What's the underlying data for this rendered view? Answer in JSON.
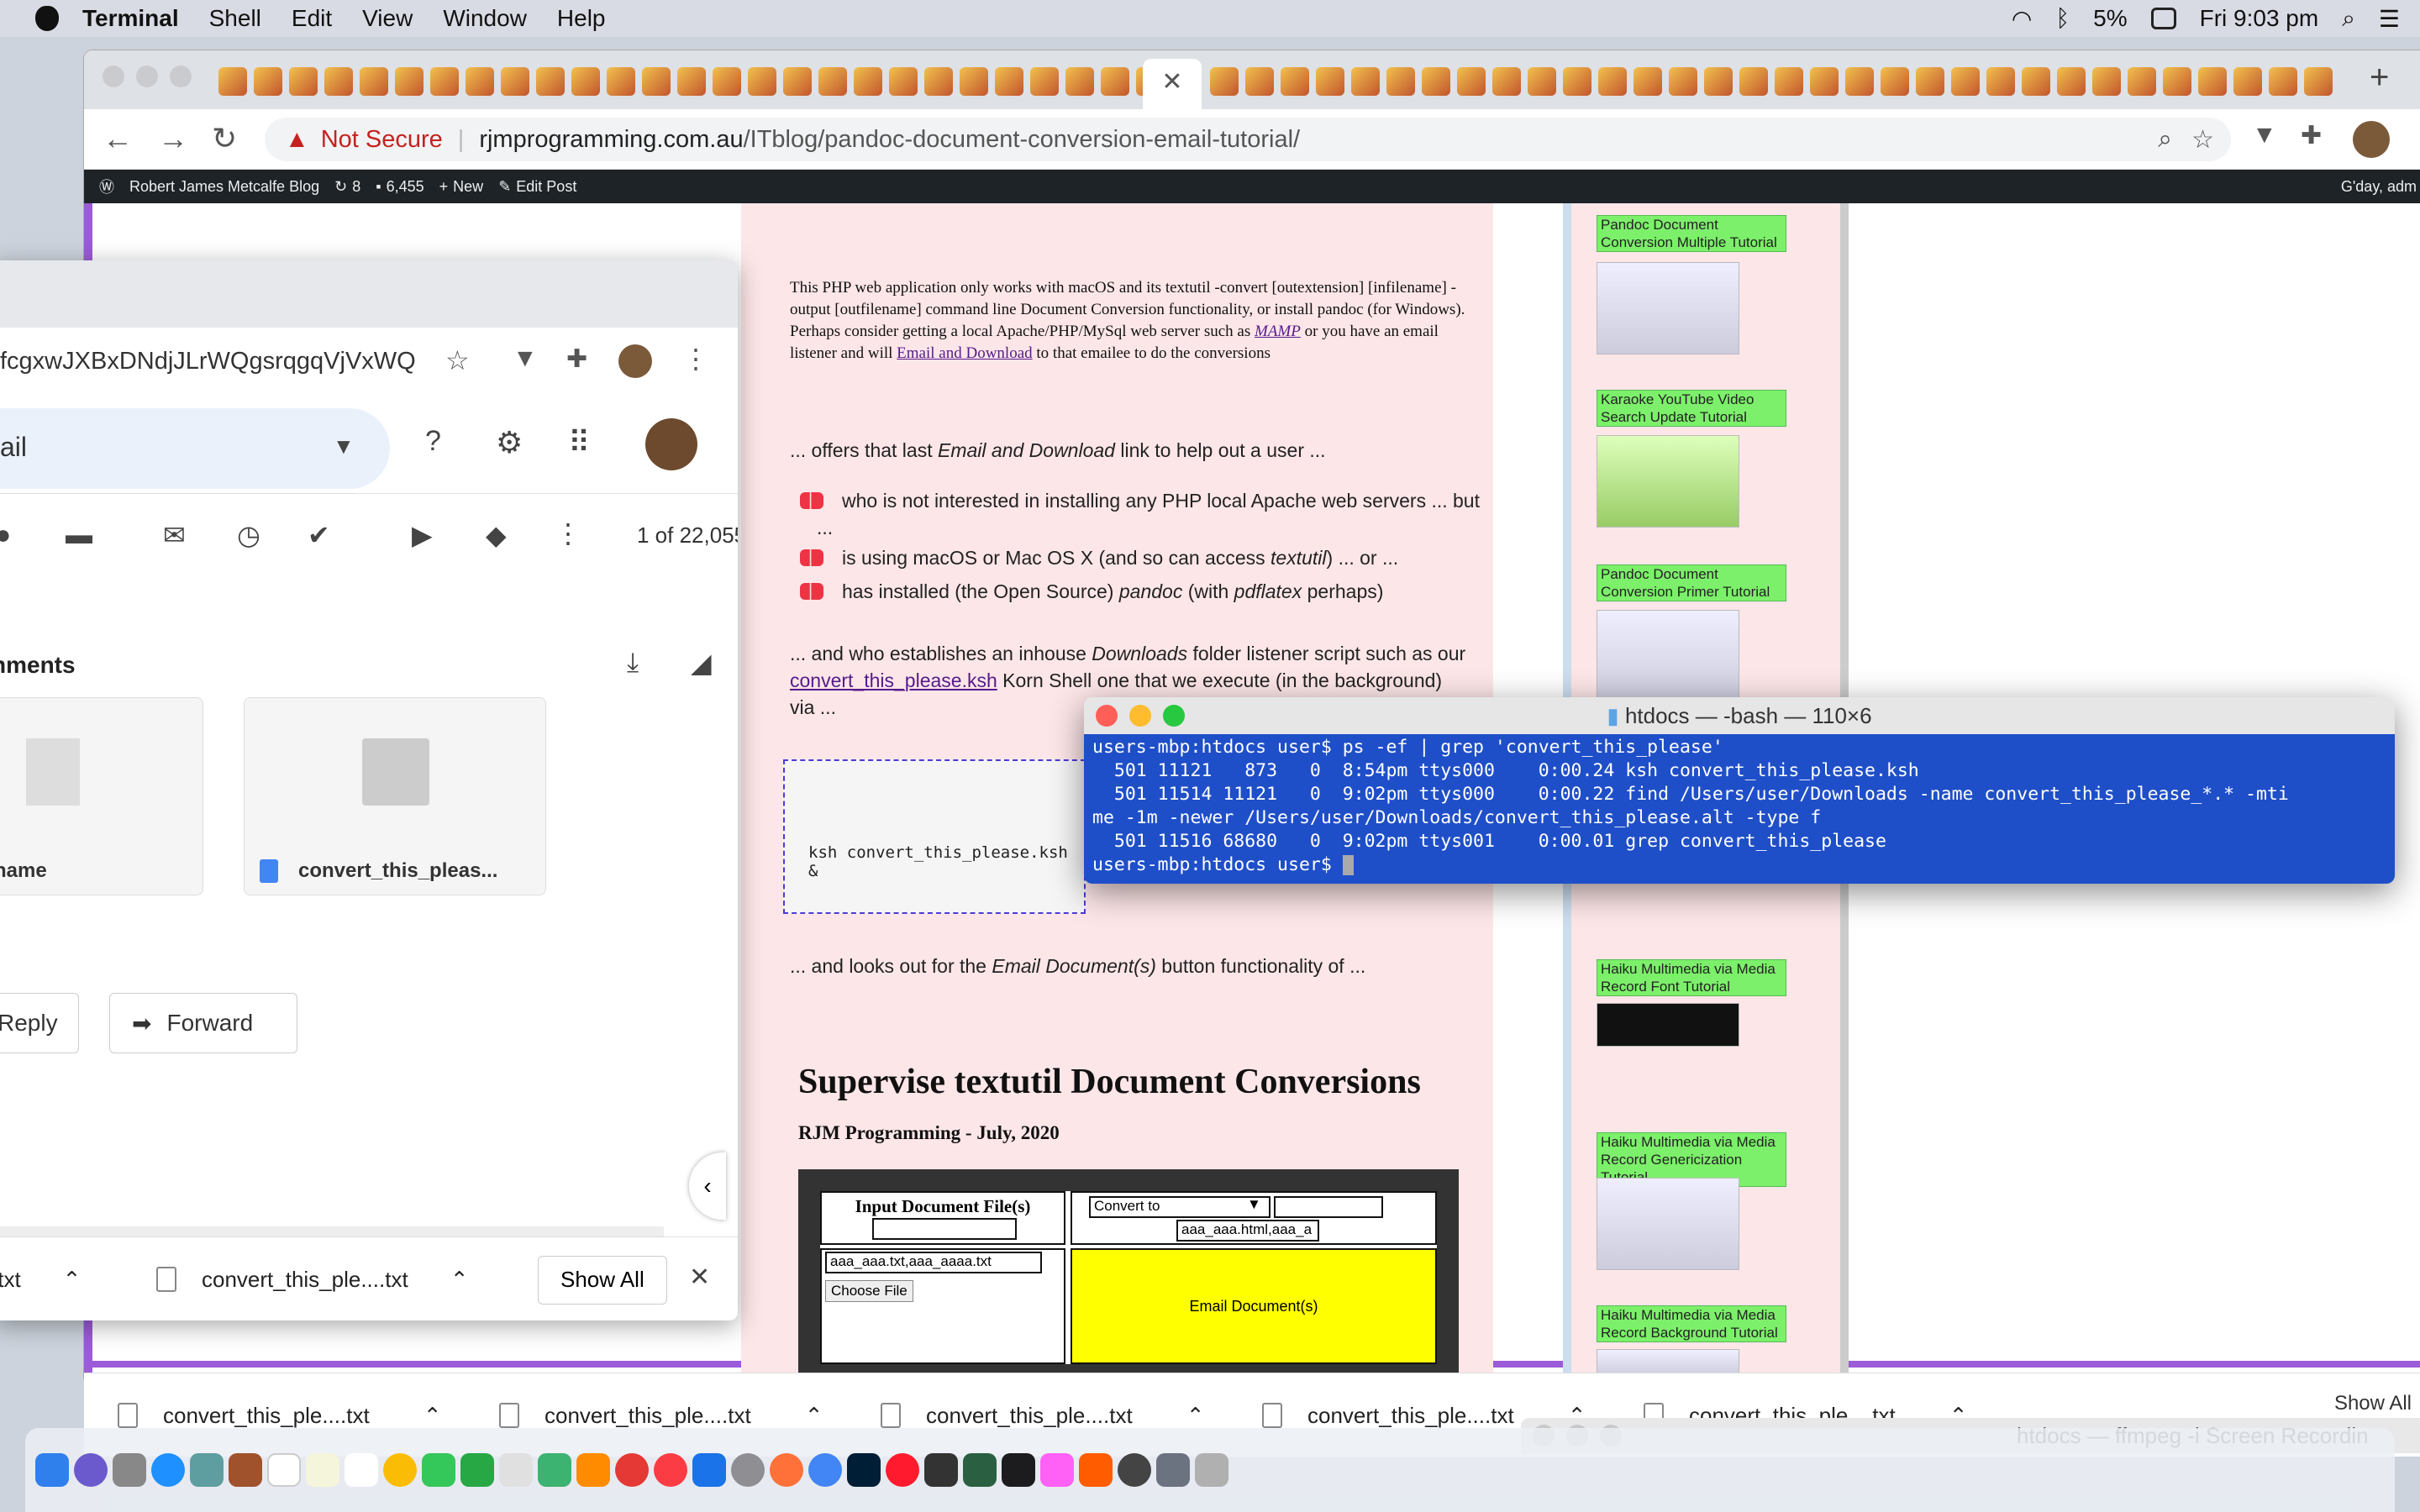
{
  "menubar": {
    "app": "Terminal",
    "items": [
      "Shell",
      "Edit",
      "View",
      "Window",
      "Help"
    ],
    "battery": "5%",
    "clock": "Fri 9:03 pm"
  },
  "browser": {
    "not_secure": "Not Secure",
    "url_host": "rjmprogramming.com.au",
    "url_path": "/ITblog/pandoc-document-conversion-email-tutorial/"
  },
  "wpbar": {
    "site": "Robert James Metcalfe Blog",
    "updates": "8",
    "comments": "6,455",
    "new": "New",
    "edit": "Edit Post",
    "greeting": "G'day, adm"
  },
  "article": {
    "banner_a": "This PHP web application only works with macOS and its textutil -convert [outextension] [infilename] -output [outfilename] command line Document Conversion functionality, or install pandoc (for Windows). Perhaps consider getting a local Apache/PHP/MySql web server such as ",
    "banner_link1": "MAMP",
    "banner_b": " or you have an email listener and will ",
    "banner_link2": "Email and Download",
    "banner_c": " to that emailee to do the conversions",
    "p1a": "... offers that last ",
    "p1i": "Email and Download",
    "p1b": " link to help out a user ...",
    "b1": "who is not interested in installing any PHP local Apache web servers ... but ...",
    "b2a": "is using macOS or Mac OS X (and so can access ",
    "b2i": "textutil",
    "b2b": ") ... or ...",
    "b3a": "has installed (the Open Source) ",
    "b3i1": "pandoc",
    "b3b": " (with ",
    "b3i2": "pdflatex",
    "b3c": " perhaps)",
    "p2a": "... and who establishes an inhouse ",
    "p2i": "Downloads",
    "p2b": " folder listener script such as our",
    "p2link": "convert_this_please.ksh",
    "p2c": " Korn Shell one that we execute (in the background)",
    "p2d": "via ...",
    "code": "ksh convert_this_please.ksh &",
    "p3a": "... and looks out for the ",
    "p3i": "Email Document(s)",
    "p3b": " button functionality of ...",
    "heading": "Supervise textutil Document Conversions",
    "byline": "RJM Programming - July, 2020",
    "form": {
      "input_label": "Input Document File(s)",
      "convert_to": "Convert to",
      "output_value": "aaa_aaa.html,aaa_a",
      "input_value": "aaa_aaa.txt,aaa_aaaa.txt",
      "choose_file": "Choose File",
      "email_btn": "Email Document(s)"
    }
  },
  "sidebar": [
    {
      "title": "Pandoc Document Conversion Multiple Tutorial"
    },
    {
      "title": "Karaoke YouTube Video Search Update Tutorial"
    },
    {
      "title": "Pandoc Document Conversion Primer Tutorial"
    },
    {
      "title": "Haiku Multimedia via Media Record Font Tutorial"
    },
    {
      "title": "Haiku Multimedia via Media Record Genericization Tutorial"
    },
    {
      "title": "Haiku Multimedia via Media Record Background Tutorial"
    }
  ],
  "gmail": {
    "url": "fcgxwJXBxDNdjJLrWQgsrqgqVjVxWQ",
    "search_text": "ail",
    "pager": "1 of 22,055",
    "attachments_label": "nments",
    "attach1": "name",
    "attach2": "convert_this_pleas...",
    "reply": "Reply",
    "forward": "Forward",
    "dl1": ".txt",
    "dl2": "convert_this_ple....txt",
    "show_all": "Show All"
  },
  "terminal": {
    "title": "htdocs — -bash — 110×6",
    "lines": [
      "users-mbp:htdocs user$ ps -ef | grep 'convert_this_please'",
      "  501 11121   873   0  8:54pm ttys000    0:00.24 ksh convert_this_please.ksh",
      "  501 11514 11121   0  9:02pm ttys000    0:00.22 find /Users/user/Downloads -name convert_this_please_*.* -mti",
      "me -1m -newer /Users/user/Downloads/convert_this_please.alt -type f",
      "  501 11516 68680   0  9:02pm ttys001    0:00.01 grep convert_this_please",
      "users-mbp:htdocs user$ "
    ]
  },
  "downloads": {
    "items": [
      "convert_this_ple....txt",
      "convert_this_ple....txt",
      "convert_this_ple....txt",
      "convert_this_ple....txt",
      "convert_this_ple....txt"
    ],
    "show_all": "Show All"
  },
  "ffmpeg_window": {
    "title": "htdocs — ffmpeg -i Screen Recordin"
  },
  "colors": {
    "terminal_bg": "#1f4fc8",
    "page_bg": "#fde6e8",
    "sidebar_highlight": "#7cf06a",
    "accent_purple": "#9c5bd8"
  }
}
